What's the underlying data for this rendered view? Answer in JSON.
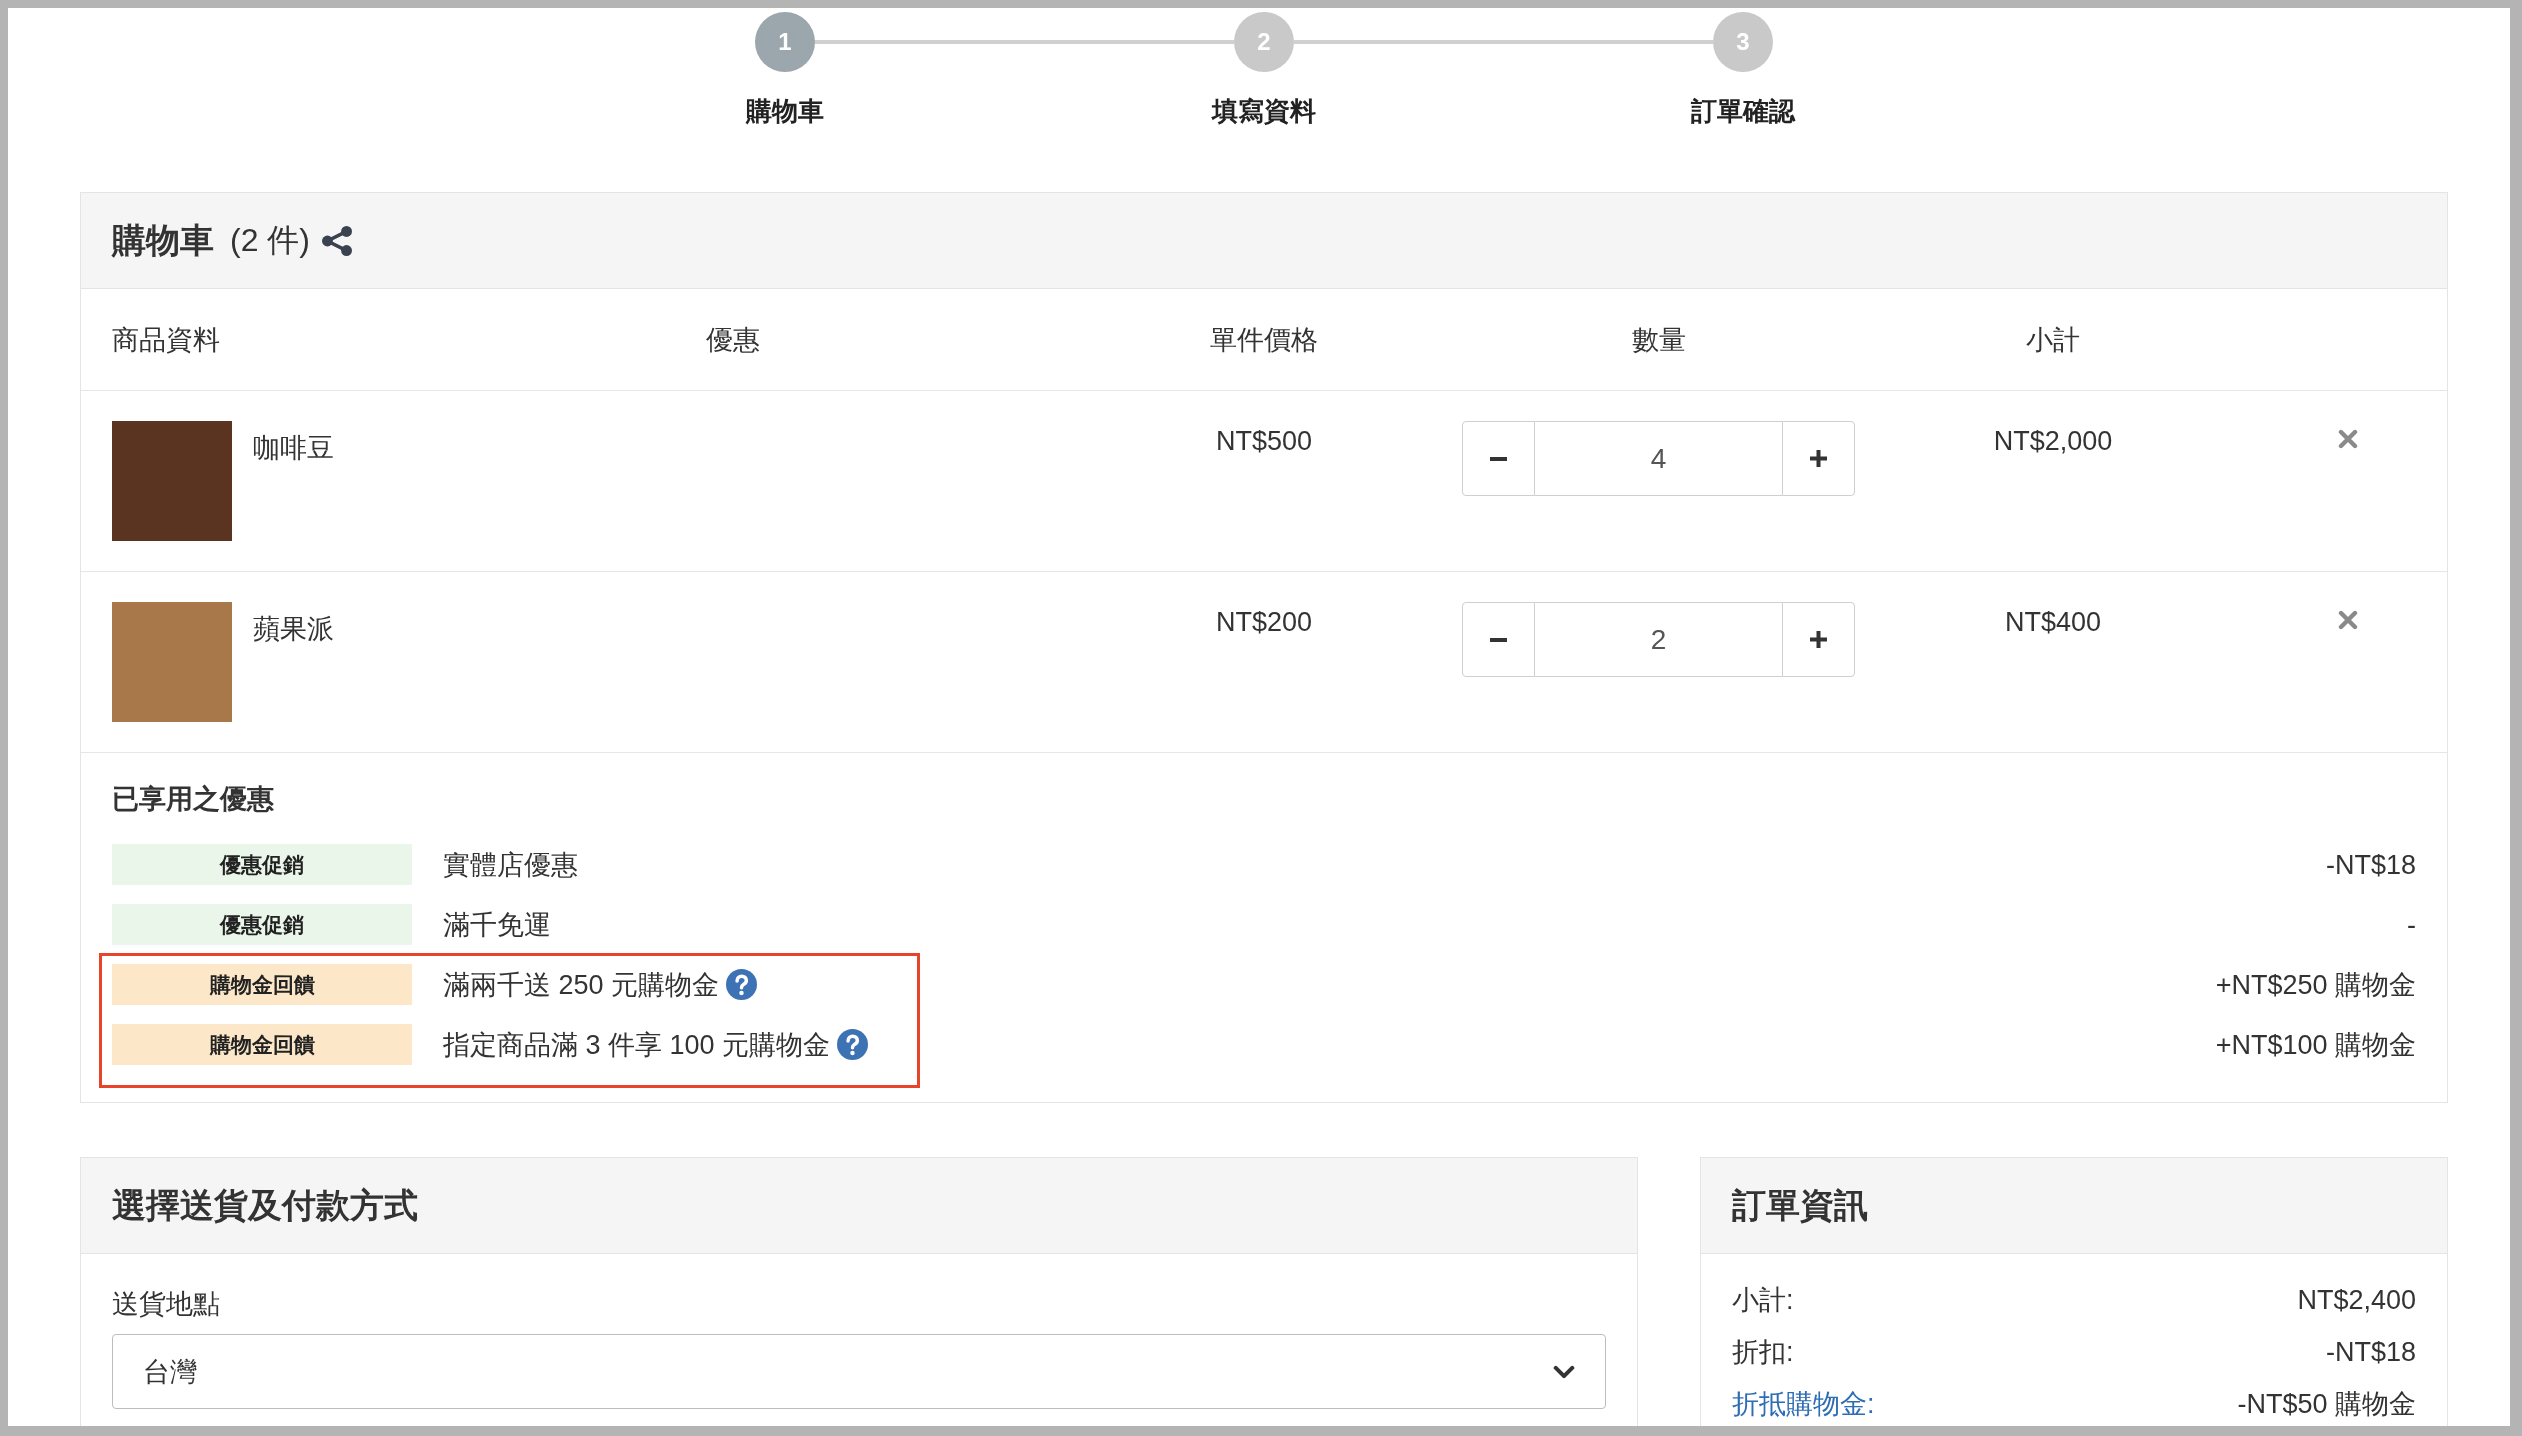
{
  "steps": [
    {
      "number": "1",
      "label": "購物車",
      "current": true
    },
    {
      "number": "2",
      "label": "填寫資料",
      "current": false
    },
    {
      "number": "3",
      "label": "訂單確認",
      "current": false
    }
  ],
  "cart": {
    "title": "購物車",
    "count": "(2 件)",
    "columns": [
      "商品資料",
      "優惠",
      "單件價格",
      "數量",
      "小計"
    ],
    "items": [
      {
        "name": "咖啡豆",
        "price": "NT$500",
        "quantity": "4",
        "subtotal": "NT$2,000"
      },
      {
        "name": "蘋果派",
        "price": "NT$200",
        "quantity": "2",
        "subtotal": "NT$400"
      }
    ],
    "discounts": {
      "title": "已享用之優惠",
      "items": [
        {
          "tag": "優惠促銷",
          "color": "#eaf6ea",
          "description": "實體店優惠",
          "help": false,
          "highlighted": false,
          "amount": "-NT$18"
        },
        {
          "tag": "優惠促銷",
          "color": "#eaf6ea",
          "description": "滿千免運",
          "help": false,
          "highlighted": false,
          "amount": "-"
        },
        {
          "tag": "購物金回饋",
          "color": "#fce8c9",
          "description": "滿兩千送 250 元購物金",
          "help": true,
          "highlighted": true,
          "amount": "+NT$250 購物金"
        },
        {
          "tag": "購物金回饋",
          "color": "#fce8c9",
          "description": "指定商品滿 3 件享 100 元購物金",
          "help": true,
          "highlighted": true,
          "amount": "+NT$100 購物金"
        }
      ]
    }
  },
  "shipping": {
    "title": "選擇送貨及付款方式",
    "field_label": "送貨地點",
    "value": "台灣"
  },
  "order": {
    "title": "訂單資訊",
    "rows": [
      {
        "label": "小計:",
        "value": "NT$2,400",
        "kind": "text"
      },
      {
        "label": "折扣:",
        "value": "-NT$18",
        "kind": "text"
      },
      {
        "label": "折抵購物金:",
        "value": "-NT$50 購物金",
        "kind": "link"
      }
    ]
  }
}
